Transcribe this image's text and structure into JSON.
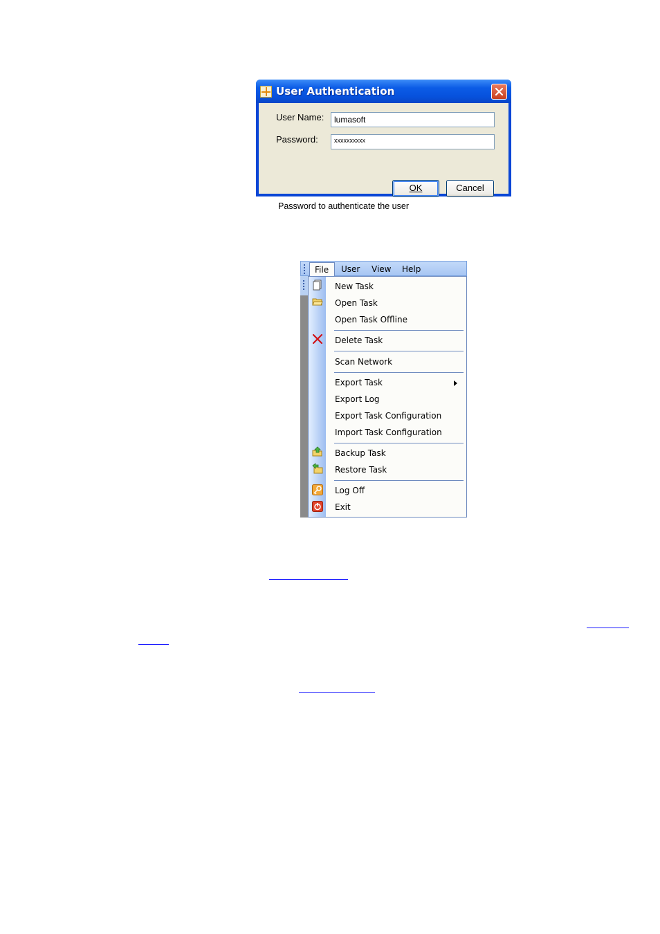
{
  "dialog": {
    "title": "User Authentication",
    "user_name_label": "User Name:",
    "user_name_value": "lumasoft",
    "password_label": "Password:",
    "password_value": "xxxxxxxxxx",
    "ok_label": "OK",
    "cancel_label": "Cancel",
    "hint": "Password to authenticate the user",
    "icons": [
      "app-icon",
      "close-icon"
    ]
  },
  "menu": {
    "bar": [
      "File",
      "User",
      "View",
      "Help"
    ],
    "items": [
      {
        "label": "New Task",
        "icon": "new-document-icon"
      },
      {
        "label": "Open Task",
        "icon": "open-folder-icon"
      },
      {
        "label": "Open Task Offline",
        "icon": ""
      },
      {
        "label": "Delete Task",
        "icon": "delete-x-icon"
      },
      {
        "label": "Scan Network",
        "icon": ""
      },
      {
        "label": "Export Task",
        "icon": "",
        "submenu": true
      },
      {
        "label": "Export Log",
        "icon": ""
      },
      {
        "label": "Export Task Configuration",
        "icon": ""
      },
      {
        "label": "Import Task Configuration",
        "icon": ""
      },
      {
        "label": "Backup Task",
        "icon": "backup-icon"
      },
      {
        "label": "Restore Task",
        "icon": "restore-icon"
      },
      {
        "label": "Log Off",
        "icon": "key-icon"
      },
      {
        "label": "Exit",
        "icon": "power-icon"
      }
    ]
  },
  "colors": {
    "title_bar": "#0752dd",
    "dialog_body": "#ece9d8",
    "menu_bar": "#b5d0f6",
    "link": "#1a1aff"
  }
}
